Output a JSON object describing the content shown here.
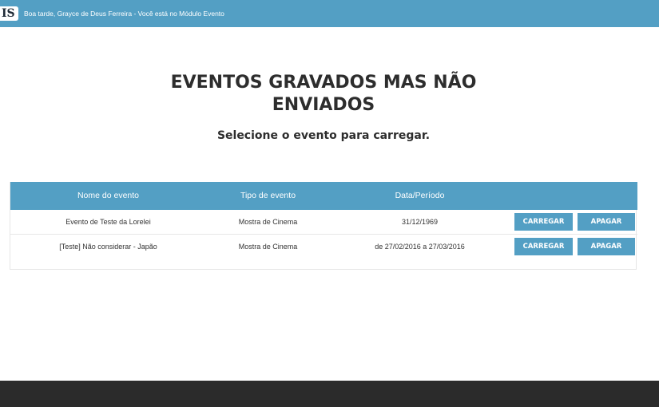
{
  "header": {
    "logo": "IS",
    "greeting": "Boa tarde, Grayce de Deus Ferreira - Você está no Módulo Evento"
  },
  "main": {
    "title_line1": "EVENTOS GRAVADOS MAS NÃO",
    "title_line2": "ENVIADOS",
    "subtitle": "Selecione o evento para carregar."
  },
  "table": {
    "columns": [
      "Nome do evento",
      "Tipo de evento",
      "Data/Período"
    ],
    "rows": [
      {
        "name": "Evento de Teste da Lorelei",
        "type": "Mostra de Cinema",
        "date": "31/12/1969",
        "load_label": "CARREGAR",
        "delete_label": "APAGAR"
      },
      {
        "name": "[Teste] Não considerar - Japão",
        "type": "Mostra de Cinema",
        "date": "de 27/02/2016 a 27/03/2016",
        "load_label": "CARREGAR",
        "delete_label": "APAGAR"
      }
    ]
  },
  "colors": {
    "accent": "#539fc4",
    "footer": "#2b2b2b",
    "text": "#2d2d2d"
  }
}
